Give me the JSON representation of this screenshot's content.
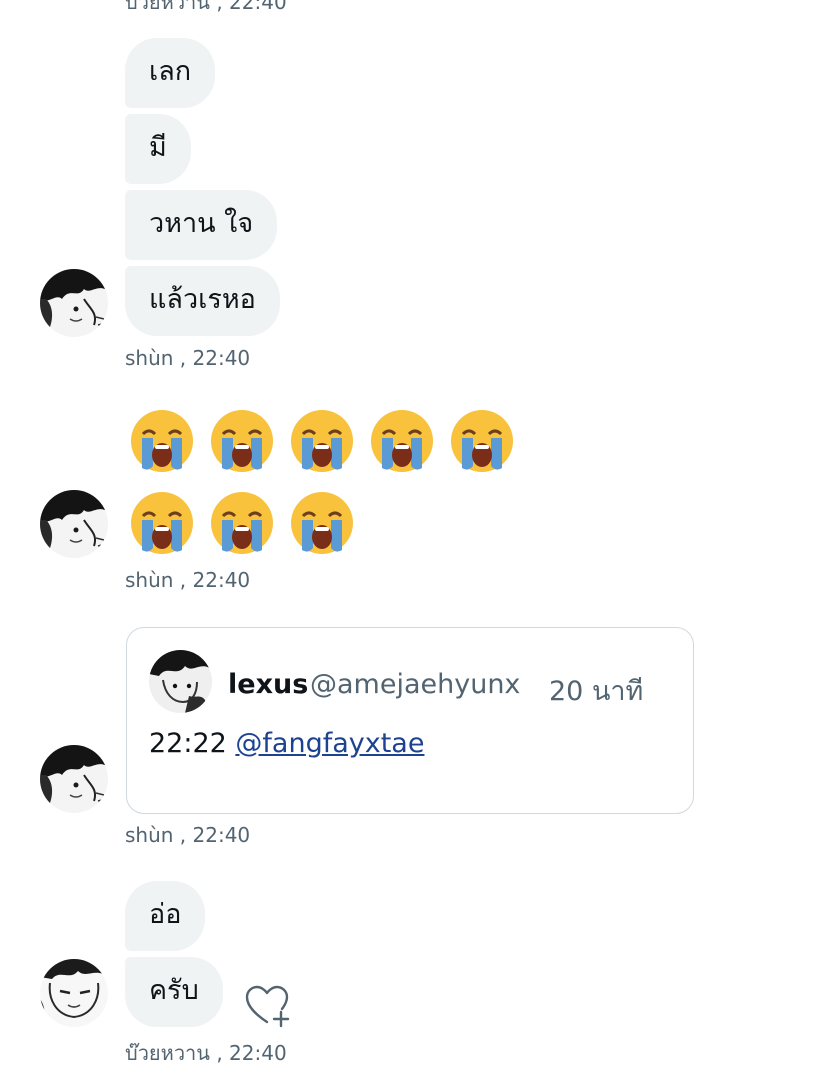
{
  "conversation": {
    "top_cutoff_meta": "บ๊วยหวาน , 22:40",
    "group1": {
      "messages": [
        "เลก",
        "มี",
        "วหาน ใจ",
        "แล้วเรหอ"
      ],
      "meta": "shùn  , 22:40"
    },
    "group2": {
      "emoji_name": "loudly-crying-face",
      "row1_count": 5,
      "row2_count": 3,
      "meta": "shùn  , 22:40"
    },
    "group3": {
      "quoted_tweet": {
        "name": "lexus",
        "handle": "@amejaehyunx",
        "time": "20 นาที",
        "body_prefix": "22:22 ",
        "mention": "@fangfayxtae"
      },
      "meta": "shùn  , 22:40"
    },
    "group4": {
      "messages": [
        "อ่อ",
        "ครับ"
      ],
      "meta": "บ๊วยหวาน  , 22:40"
    }
  },
  "colors": {
    "bubble": "#eff3f4",
    "meta_text": "#536471",
    "link": "#1d4390",
    "card_border": "#cfd9de"
  },
  "icons": {
    "reaction": "heart-plus-icon"
  }
}
